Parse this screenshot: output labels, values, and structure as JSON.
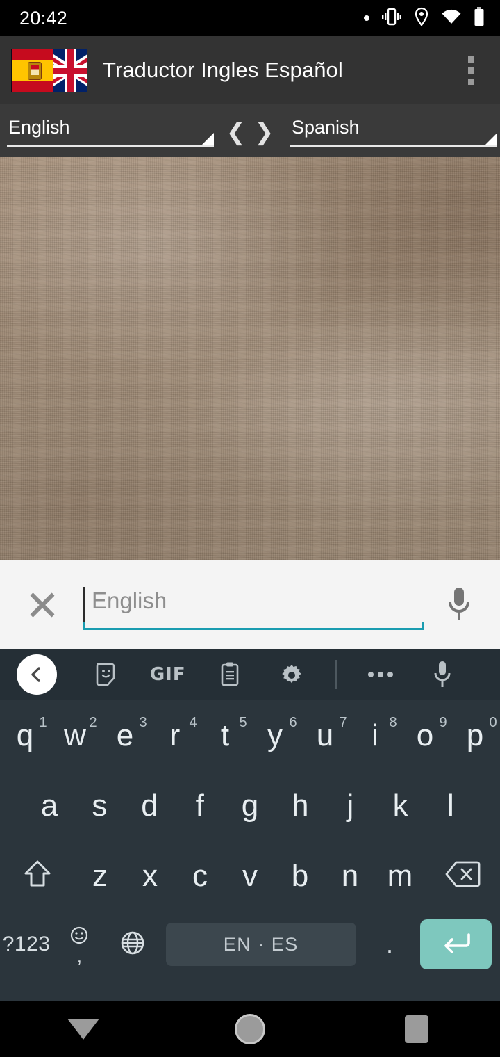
{
  "statusbar": {
    "time": "20:42",
    "icons": [
      "dot-indicator-icon",
      "vibrate-icon",
      "location-pin-icon",
      "wifi-icon",
      "battery-icon"
    ]
  },
  "actionbar": {
    "title": "Traductor Ingles Español",
    "app_icon": "spain-uk-flag-icon",
    "overflow_icon": "overflow-menu-icon"
  },
  "language_bar": {
    "source_language": "English",
    "target_language": "Spanish",
    "swap_left": "❮",
    "swap_right": "❯"
  },
  "canvas": {
    "background": "#9e8a75",
    "description": ""
  },
  "input_row": {
    "clear_icon": "close-x-icon",
    "placeholder": "English",
    "value": "",
    "underline_color": "#1a9cb0",
    "mic_icon": "microphone-icon"
  },
  "keyboard": {
    "toolbar": {
      "items": [
        {
          "name": "back-chevron-button",
          "icon": "chevron-left-icon"
        },
        {
          "name": "sticker-button",
          "icon": "sticker-icon"
        },
        {
          "name": "gif-button",
          "icon": "gif-icon",
          "label": "GIF"
        },
        {
          "name": "clipboard-button",
          "icon": "clipboard-icon"
        },
        {
          "name": "settings-button",
          "icon": "gear-icon"
        },
        {
          "name": "more-options-button",
          "icon": "three-dots-icon"
        },
        {
          "name": "voice-input-button",
          "icon": "microphone-icon"
        }
      ]
    },
    "row1": [
      {
        "letter": "q",
        "num": "1"
      },
      {
        "letter": "w",
        "num": "2"
      },
      {
        "letter": "e",
        "num": "3"
      },
      {
        "letter": "r",
        "num": "4"
      },
      {
        "letter": "t",
        "num": "5"
      },
      {
        "letter": "y",
        "num": "6"
      },
      {
        "letter": "u",
        "num": "7"
      },
      {
        "letter": "i",
        "num": "8"
      },
      {
        "letter": "o",
        "num": "9"
      },
      {
        "letter": "p",
        "num": "0"
      }
    ],
    "row2": [
      "a",
      "s",
      "d",
      "f",
      "g",
      "h",
      "j",
      "k",
      "l"
    ],
    "row3": [
      "z",
      "x",
      "c",
      "v",
      "b",
      "n",
      "m"
    ],
    "shift_icon": "shift-arrow-icon",
    "backspace_icon": "backspace-icon",
    "row4": {
      "symbols_label": "?123",
      "emoji_icon": "emoji-smiley-icon",
      "comma_label": ",",
      "globe_icon": "globe-language-icon",
      "space_label": "EN · ES",
      "period_label": ".",
      "enter_icon": "enter-return-icon",
      "enter_color": "#7ec8be"
    }
  },
  "navbar": {
    "back_icon": "dismiss-keyboard-triangle-icon",
    "home_icon": "home-circle-icon",
    "recents_icon": "recents-square-icon"
  }
}
